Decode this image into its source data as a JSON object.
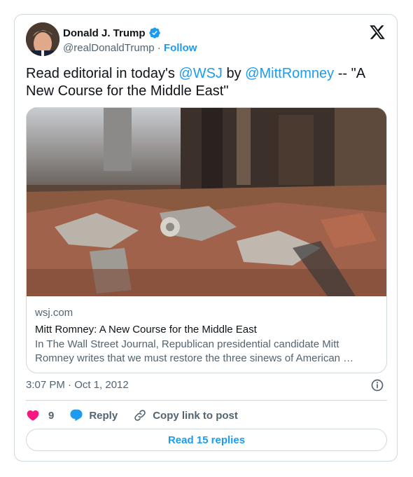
{
  "author": {
    "name": "Donald J. Trump",
    "handle": "@realDonaldTrump",
    "separator": "·",
    "follow_label": "Follow"
  },
  "tweet": {
    "text_pre": "Read editorial in today's ",
    "mention1": "@WSJ",
    "text_mid": " by ",
    "mention2": "@MittRomney",
    "text_post": " -- \"A New Course for the Middle East\""
  },
  "link_card": {
    "domain": "wsj.com",
    "title": "Mitt Romney: A New Course for the Middle East",
    "description": "In The Wall Street Journal, Republican presidential candidate Mitt Romney writes that we must restore the three sinews of American …"
  },
  "timestamp": "3:07 PM · Oct 1, 2012",
  "actions": {
    "like_count": "9",
    "reply_label": "Reply",
    "copy_label": "Copy link to post"
  },
  "read_replies_label": "Read 15 replies",
  "colors": {
    "accent": "#1d9bf0",
    "like": "#f91880",
    "text": "#0f1419",
    "muted": "#536471",
    "border": "#cfd9de"
  },
  "icons": {
    "verified": "verified-badge-icon",
    "logo": "x-logo-icon",
    "info": "info-icon",
    "like": "heart-icon",
    "reply": "speech-bubble-icon",
    "copy": "link-icon"
  }
}
